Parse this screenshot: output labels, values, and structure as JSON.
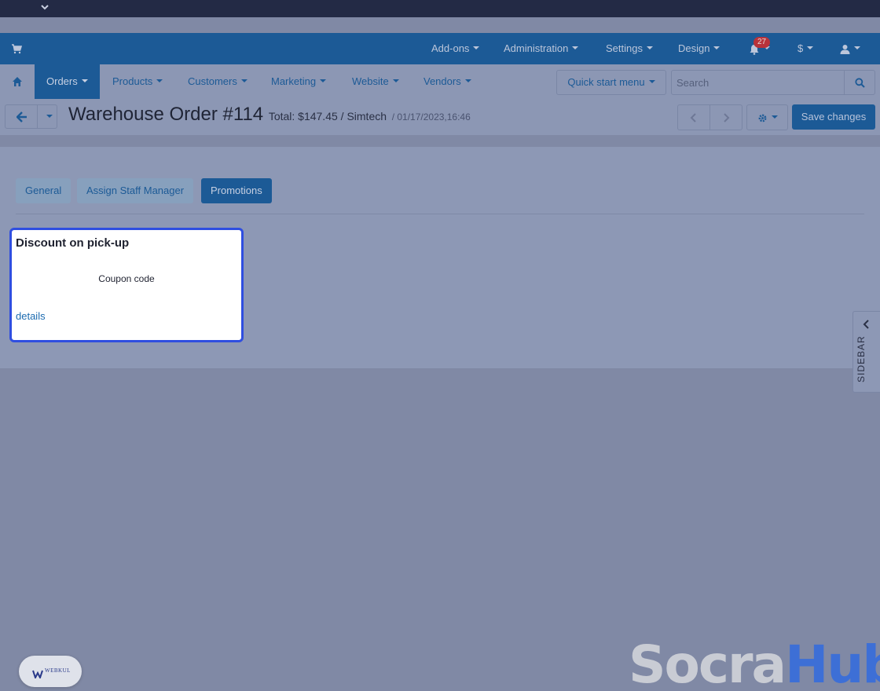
{
  "colors": {
    "brand_blue": "#1c5a96",
    "overlay": "#8089a5",
    "selection_border": "#2f4ee0",
    "badge_red": "#b8323a",
    "link": "#1c6bb0"
  },
  "topbar": {
    "menus": [
      {
        "label": "Add-ons"
      },
      {
        "label": "Administration"
      },
      {
        "label": "Settings"
      },
      {
        "label": "Design"
      }
    ],
    "notifications_count": "27",
    "currency": "$",
    "icons": [
      "cart-icon",
      "bell-icon",
      "user-icon",
      "chevron-down-icon"
    ]
  },
  "navbar": {
    "items": [
      {
        "label": "Orders",
        "active": true
      },
      {
        "label": "Products"
      },
      {
        "label": "Customers"
      },
      {
        "label": "Marketing"
      },
      {
        "label": "Website"
      },
      {
        "label": "Vendors"
      }
    ],
    "quick_start": "Quick start menu",
    "search_placeholder": "Search"
  },
  "header": {
    "title": "Warehouse Order #114",
    "total": "Total: $147.45 / Simtech",
    "date": "/ 01/17/2023,16:46",
    "save_label": "Save changes"
  },
  "tabs": [
    {
      "label": "General"
    },
    {
      "label": "Assign Staff Manager"
    },
    {
      "label": "Promotions",
      "active": true
    }
  ],
  "promotion": {
    "title": "Discount on pick-up",
    "coupon_label": "Coupon code",
    "details_link": "details"
  },
  "sidebar": {
    "label": "SIDEBAR"
  },
  "watermark": {
    "logo_text": "WEBKUL",
    "part1": "Socra",
    "part2": "Hub"
  }
}
